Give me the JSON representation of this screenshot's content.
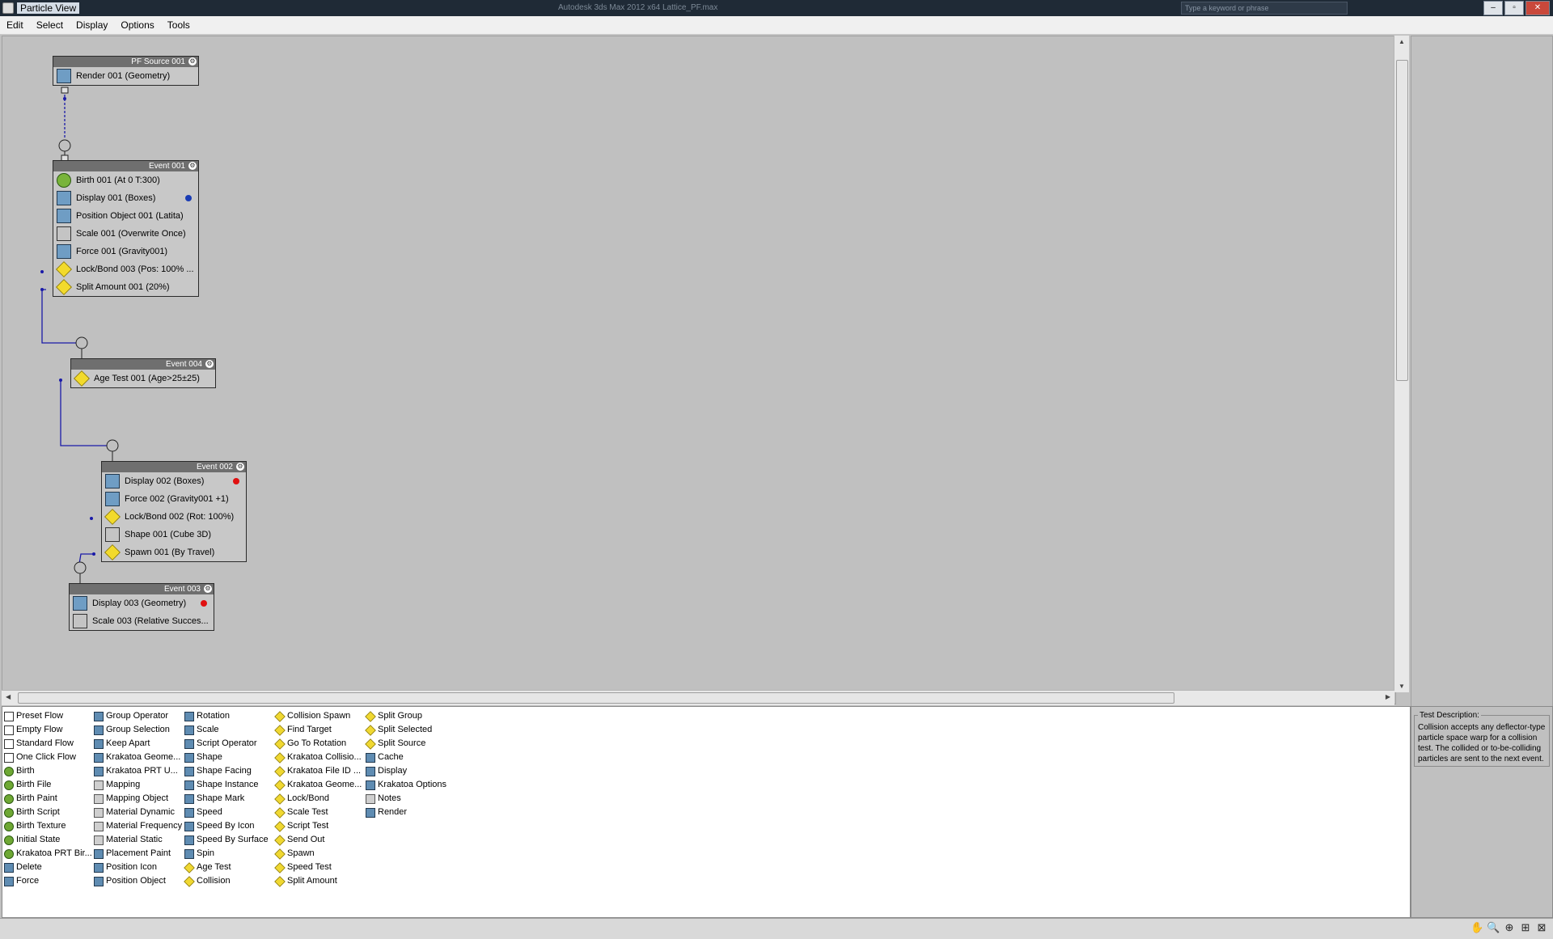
{
  "window": {
    "title": "Particle View",
    "app_faded": "Autodesk 3ds Max 2012 x64     Lattice_PF.max",
    "search_placeholder": "Type a keyword or phrase"
  },
  "menu": [
    "Edit",
    "Select",
    "Display",
    "Options",
    "Tools"
  ],
  "nodes": {
    "source": {
      "title": "PF Source 001",
      "rows": [
        {
          "label": "Render 001 (Geometry)"
        }
      ]
    },
    "event001": {
      "title": "Event 001",
      "rows": [
        {
          "label": "Birth 001 (At 0 T:300)"
        },
        {
          "label": "Display 001 (Boxes)",
          "dot": "#1a3cb4"
        },
        {
          "label": "Position Object 001 (Latita)"
        },
        {
          "label": "Scale 001 (Overwrite Once)"
        },
        {
          "label": "Force 001 (Gravity001)"
        },
        {
          "label": "Lock/Bond 003 (Pos: 100% ..."
        },
        {
          "label": "Split Amount 001 (20%)"
        }
      ]
    },
    "event004": {
      "title": "Event 004",
      "rows": [
        {
          "label": "Age Test 001 (Age>25±25)"
        }
      ]
    },
    "event002": {
      "title": "Event 002",
      "rows": [
        {
          "label": "Display 002 (Boxes)",
          "dot": "#e01010"
        },
        {
          "label": "Force 002 (Gravity001 +1)"
        },
        {
          "label": "Lock/Bond 002 (Rot: 100%)"
        },
        {
          "label": "Shape 001 (Cube 3D)"
        },
        {
          "label": "Spawn 001 (By Travel)"
        }
      ]
    },
    "event003": {
      "title": "Event 003",
      "rows": [
        {
          "label": "Display 003 (Geometry)",
          "dot": "#e01010"
        },
        {
          "label": "Scale 003 (Relative Succes..."
        }
      ]
    }
  },
  "depot": {
    "col1": [
      {
        "label": "Preset Flow",
        "icon": "flow"
      },
      {
        "label": "Empty Flow",
        "icon": "flow"
      },
      {
        "label": "Standard Flow",
        "icon": "flow"
      },
      {
        "label": "One Click Flow",
        "icon": "flow"
      },
      {
        "label": "Birth",
        "icon": "green"
      },
      {
        "label": "Birth File",
        "icon": "green"
      },
      {
        "label": "Birth Paint",
        "icon": "green"
      },
      {
        "label": "Birth Script",
        "icon": "green"
      },
      {
        "label": "Birth Texture",
        "icon": "green"
      },
      {
        "label": "Initial State",
        "icon": "green"
      },
      {
        "label": "Krakatoa PRT Bir...",
        "icon": "green"
      },
      {
        "label": "Delete",
        "icon": "blue"
      },
      {
        "label": "Force",
        "icon": "blue"
      }
    ],
    "col2": [
      {
        "label": "Group Operator",
        "icon": "blue"
      },
      {
        "label": "Group Selection",
        "icon": "blue"
      },
      {
        "label": "Keep Apart",
        "icon": "blue"
      },
      {
        "label": "Krakatoa Geome...",
        "icon": "blue"
      },
      {
        "label": "Krakatoa PRT U...",
        "icon": "blue"
      },
      {
        "label": "Mapping",
        "icon": "gray"
      },
      {
        "label": "Mapping Object",
        "icon": "gray"
      },
      {
        "label": "Material Dynamic",
        "icon": "gray"
      },
      {
        "label": "Material Frequency",
        "icon": "gray"
      },
      {
        "label": "Material Static",
        "icon": "gray"
      },
      {
        "label": "Placement Paint",
        "icon": "blue"
      },
      {
        "label": "Position Icon",
        "icon": "blue"
      },
      {
        "label": "Position Object",
        "icon": "blue"
      }
    ],
    "col3": [
      {
        "label": "Rotation",
        "icon": "blue"
      },
      {
        "label": "Scale",
        "icon": "blue"
      },
      {
        "label": "Script Operator",
        "icon": "blue"
      },
      {
        "label": "Shape",
        "icon": "blue"
      },
      {
        "label": "Shape Facing",
        "icon": "blue"
      },
      {
        "label": "Shape Instance",
        "icon": "blue"
      },
      {
        "label": "Shape Mark",
        "icon": "blue"
      },
      {
        "label": "Speed",
        "icon": "blue"
      },
      {
        "label": "Speed By Icon",
        "icon": "blue"
      },
      {
        "label": "Speed By Surface",
        "icon": "blue"
      },
      {
        "label": "Spin",
        "icon": "blue"
      },
      {
        "label": "Age Test",
        "icon": "yellow"
      },
      {
        "label": "Collision",
        "icon": "yellow"
      }
    ],
    "col4": [
      {
        "label": "Collision Spawn",
        "icon": "yellow"
      },
      {
        "label": "Find Target",
        "icon": "yellow"
      },
      {
        "label": "Go To Rotation",
        "icon": "yellow"
      },
      {
        "label": "Krakatoa Collisio...",
        "icon": "yellow"
      },
      {
        "label": "Krakatoa File ID ...",
        "icon": "yellow"
      },
      {
        "label": "Krakatoa Geome...",
        "icon": "yellow"
      },
      {
        "label": "Lock/Bond",
        "icon": "yellow"
      },
      {
        "label": "Scale Test",
        "icon": "yellow"
      },
      {
        "label": "Script Test",
        "icon": "yellow"
      },
      {
        "label": "Send Out",
        "icon": "yellow"
      },
      {
        "label": "Spawn",
        "icon": "yellow"
      },
      {
        "label": "Speed Test",
        "icon": "yellow"
      },
      {
        "label": "Split Amount",
        "icon": "yellow"
      }
    ],
    "col5": [
      {
        "label": "Split Group",
        "icon": "yellow"
      },
      {
        "label": "Split Selected",
        "icon": "yellow"
      },
      {
        "label": "Split Source",
        "icon": "yellow"
      },
      {
        "label": "Cache",
        "icon": "blue"
      },
      {
        "label": "Display",
        "icon": "blue"
      },
      {
        "label": "Krakatoa Options",
        "icon": "blue"
      },
      {
        "label": "Notes",
        "icon": "gray"
      },
      {
        "label": "Render",
        "icon": "blue"
      }
    ]
  },
  "description": {
    "legend": "Test Description:",
    "text": "Collision accepts any deflector-type particle space warp for a collision test. The collided or to-be-colliding particles are sent to the next event."
  },
  "status_tools": [
    "pan-icon",
    "zoom-icon",
    "zoom-region-icon",
    "zoom-extents-icon",
    "no-zoom-icon"
  ],
  "colors": {
    "canvas": "#c0c0c0",
    "wire": "#1a1aa8",
    "node_header": "#6f6f6f"
  }
}
